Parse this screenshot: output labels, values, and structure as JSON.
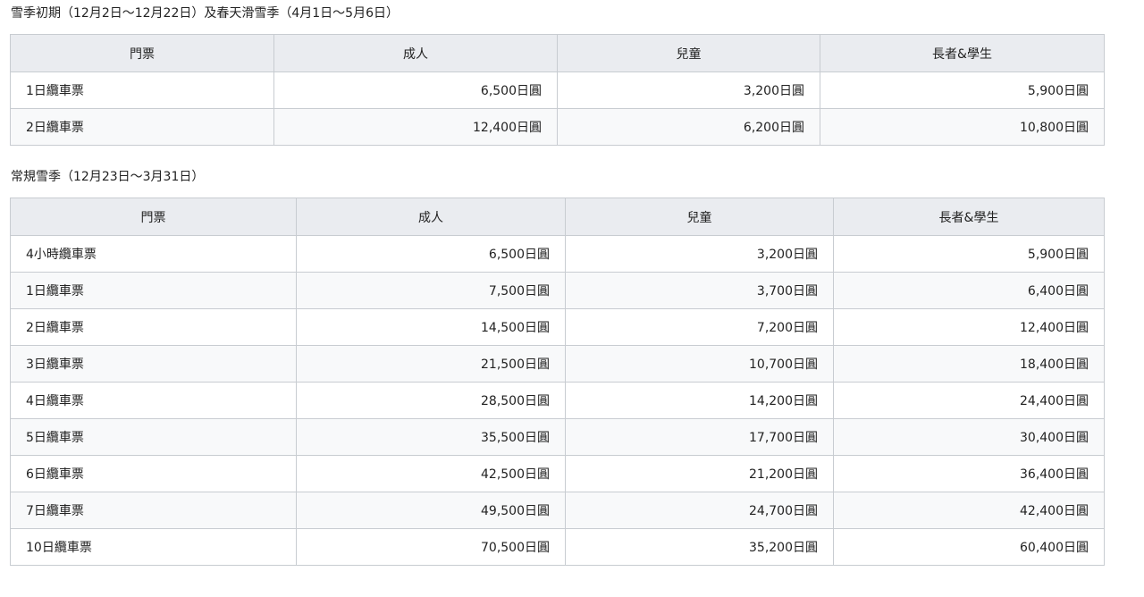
{
  "sections": [
    {
      "title": "雪季初期（12月2日～12月22日）及春天滑雪季（4月1日～5月6日）",
      "headers": [
        "門票",
        "成人",
        "兒童",
        "長者&學生"
      ],
      "rows": [
        [
          "1日纜車票",
          "6,500日圓",
          "3,200日圓",
          "5,900日圓"
        ],
        [
          "2日纜車票",
          "12,400日圓",
          "6,200日圓",
          "10,800日圓"
        ]
      ]
    },
    {
      "title": "常規雪季（12月23日～3月31日）",
      "headers": [
        "門票",
        "成人",
        "兒童",
        "長者&學生"
      ],
      "rows": [
        [
          "4小時纜車票",
          "6,500日圓",
          "3,200日圓",
          "5,900日圓"
        ],
        [
          "1日纜車票",
          "7,500日圓",
          "3,700日圓",
          "6,400日圓"
        ],
        [
          "2日纜車票",
          "14,500日圓",
          "7,200日圓",
          "12,400日圓"
        ],
        [
          "3日纜車票",
          "21,500日圓",
          "10,700日圓",
          "18,400日圓"
        ],
        [
          "4日纜車票",
          "28,500日圓",
          "14,200日圓",
          "24,400日圓"
        ],
        [
          "5日纜車票",
          "35,500日圓",
          "17,700日圓",
          "30,400日圓"
        ],
        [
          "6日纜車票",
          "42,500日圓",
          "21,200日圓",
          "36,400日圓"
        ],
        [
          "7日纜車票",
          "49,500日圓",
          "24,700日圓",
          "42,400日圓"
        ],
        [
          "10日纜車票",
          "70,500日圓",
          "35,200日圓",
          "60,400日圓"
        ]
      ]
    }
  ],
  "colors": {
    "header_bg": "#eaecf0",
    "border": "#c8ccd1",
    "row_alt_bg": "#f8f9fa",
    "text": "#222222"
  }
}
